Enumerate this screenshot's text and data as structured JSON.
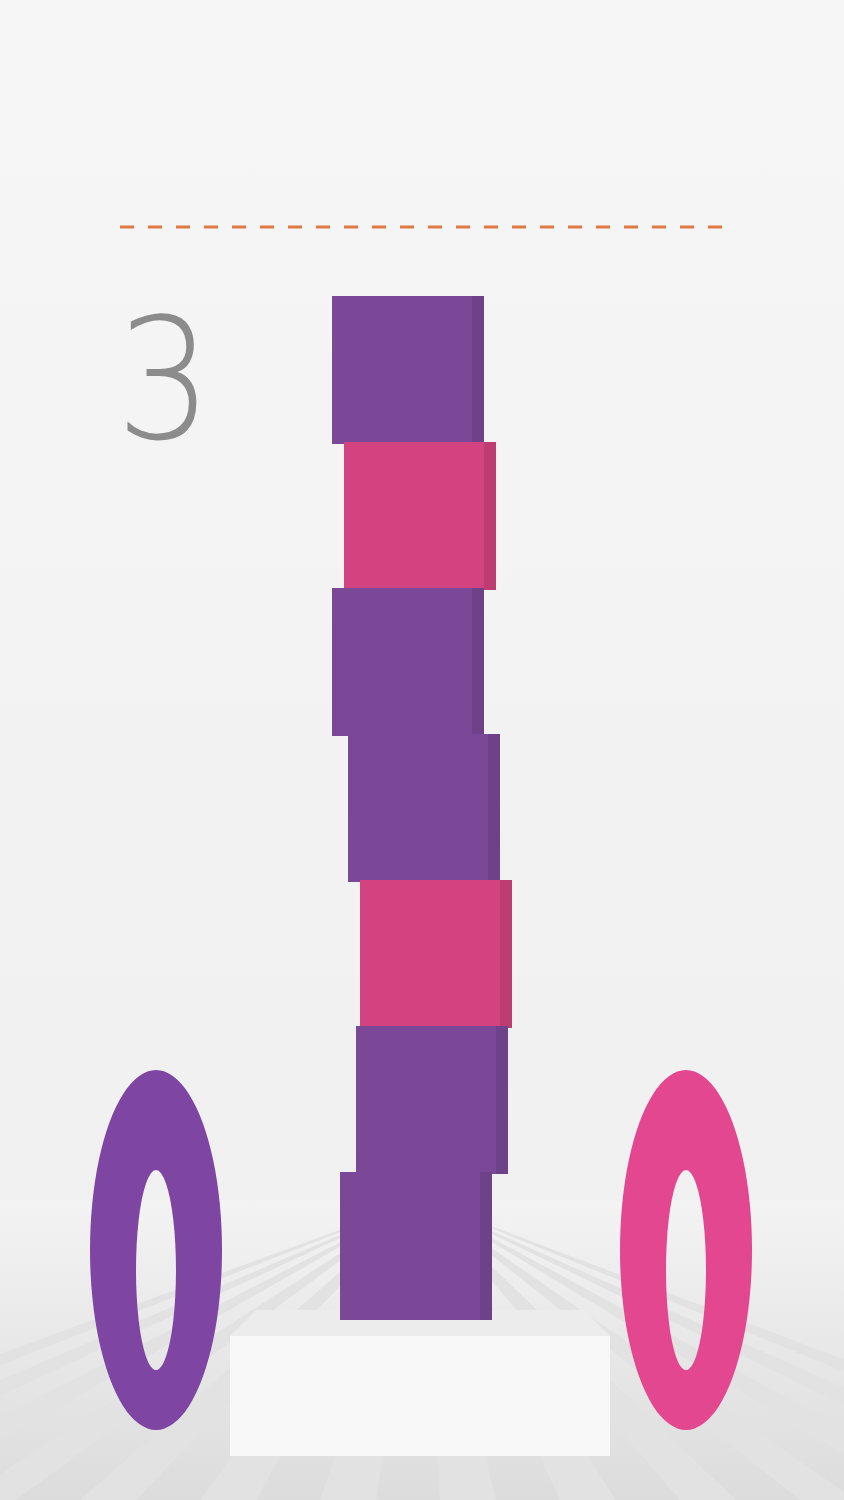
{
  "score": "3",
  "blocks": [
    {
      "color": "#7b4898"
    },
    {
      "color": "#d2437f"
    },
    {
      "color": "#7b4898"
    },
    {
      "color": "#7b4898"
    },
    {
      "color": "#d2437f"
    },
    {
      "color": "#7b4898"
    },
    {
      "color": "#7b4898"
    }
  ],
  "rings": [
    {
      "color": "#7e46a2"
    },
    {
      "color": "#e2478f"
    }
  ]
}
